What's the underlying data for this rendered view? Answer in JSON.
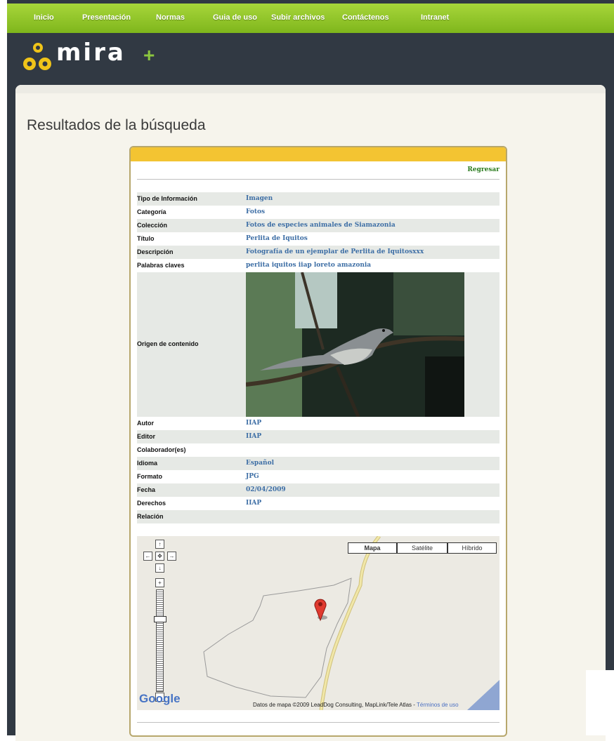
{
  "nav": {
    "items": [
      "Inicio",
      "Presentación",
      "Normas",
      "Guia de uso",
      "Subir archivos",
      "Contáctenos",
      "Intranet"
    ]
  },
  "logo": {
    "text": "mira",
    "plus": "+"
  },
  "page": {
    "heading": "Resultados de la búsqueda"
  },
  "panel": {
    "back_link": "Regresar",
    "image_label": "Origen de contenido",
    "rows_top": [
      {
        "label": "Tipo de Información",
        "value": "Imagen"
      },
      {
        "label": "Categoría",
        "value": "Fotos"
      },
      {
        "label": "Colección",
        "value": "Fotos de especies animales de Siamazonia"
      },
      {
        "label": "Título",
        "value": "Perlita de Iquitos"
      },
      {
        "label": "Descripción",
        "value": "Fotografía de un ejemplar de Perlita de Iquitosxxx"
      },
      {
        "label": "Palabras claves",
        "value": "perlita iquitos iiap loreto amazonia"
      }
    ],
    "rows_bottom": [
      {
        "label": "Autor",
        "value": "IIAP"
      },
      {
        "label": "Editor",
        "value": "IIAP"
      },
      {
        "label": "Colaborador(es)",
        "value": ""
      },
      {
        "label": "Idioma",
        "value": "Español"
      },
      {
        "label": "Formato",
        "value": "JPG"
      },
      {
        "label": "Fecha",
        "value": "02/04/2009"
      },
      {
        "label": "Derechos",
        "value": "IIAP"
      },
      {
        "label": "Relación",
        "value": ""
      }
    ]
  },
  "map": {
    "types": [
      "Mapa",
      "Satélite",
      "Híbrido"
    ],
    "selected_type": "Mapa",
    "attribution": "Datos de mapa ©2009 LeadDog Consulting, MapLink/Tele Atlas - ",
    "terms": "Términos de uso",
    "google_logo": "Google",
    "controls": {
      "up": "↑",
      "down": "↓",
      "left": "←",
      "right": "→",
      "center": "✥",
      "zoom_in": "+",
      "zoom_out": "−"
    }
  },
  "colors": {
    "nav_green": "#8cc63f",
    "header_dark": "#313943",
    "panel_header": "#f3c432",
    "value_blue": "#3d6ea5",
    "link_green": "#2a7b1e"
  }
}
